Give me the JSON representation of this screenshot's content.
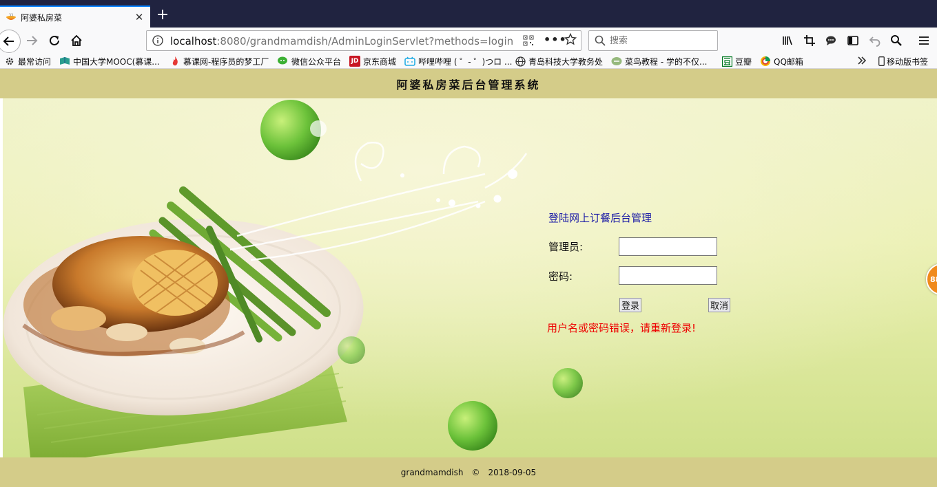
{
  "browser": {
    "tab": {
      "title": "阿婆私房菜",
      "close": "✕"
    },
    "new_tab": "+",
    "url": {
      "host": "localhost",
      "rest": ":8080/grandmamdish/AdminLoginServlet?methods=login"
    },
    "url_menu": "•••",
    "search_placeholder": "搜索",
    "bookmarks": [
      {
        "label": "最常访问",
        "icon": "gear-icon"
      },
      {
        "label": "中国大学MOOC(慕课...",
        "icon": "mooc-icon"
      },
      {
        "label": "慕课网-程序员的梦工厂",
        "icon": "flame-icon"
      },
      {
        "label": "微信公众平台",
        "icon": "wechat-icon"
      },
      {
        "label": "京东商城",
        "icon": "jd-icon"
      },
      {
        "label": "哔哩哔哩 ( ゜- ゜)つロ ...",
        "icon": "bilibili-icon"
      },
      {
        "label": "青岛科技大学教务处",
        "icon": "globe-icon"
      },
      {
        "label": "菜鸟教程 - 学的不仅...",
        "icon": "runoob-icon"
      },
      {
        "label": "豆瓣",
        "icon": "douban-icon"
      },
      {
        "label": "QQ邮箱",
        "icon": "qqmail-icon"
      }
    ],
    "mobile_bookmarks": "移动版书签",
    "jd_icon_text": "JD",
    "side_badge_text": "88"
  },
  "page": {
    "header_title": "阿婆私房菜后台管理系统",
    "login": {
      "title": "登陆网上订餐后台管理",
      "admin_label": "管理员:",
      "admin_value": "",
      "password_label": "密码:",
      "password_value": "",
      "login_button": "登录",
      "cancel_button": "取消",
      "error_message": "用户名或密码错误，请重新登录!"
    },
    "footer": {
      "brand": "grandmamdish",
      "copyright": "©",
      "date": "2018-09-05"
    }
  },
  "colors": {
    "titlebar": "#202340",
    "accent": "#0a84ff",
    "page_header": "#d4cc89",
    "login_title": "#1a1aa6",
    "error": "#ee0000"
  }
}
